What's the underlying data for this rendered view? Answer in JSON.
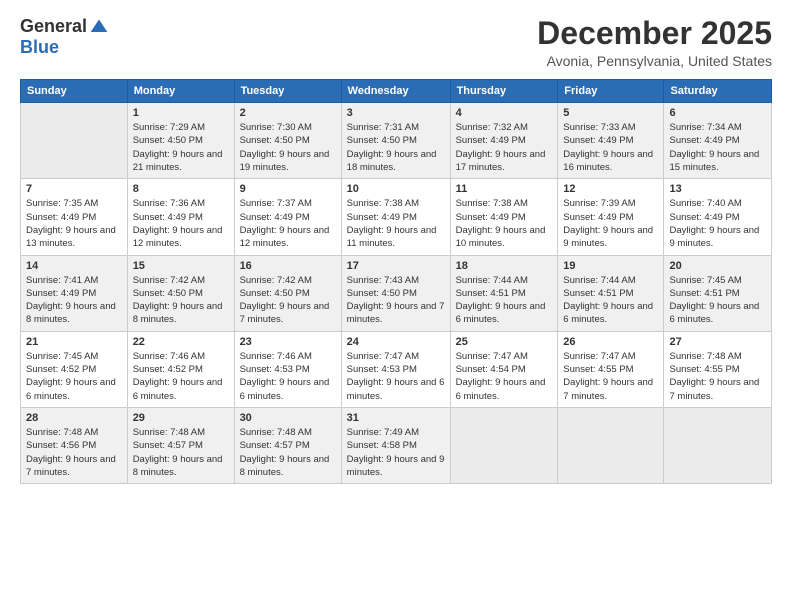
{
  "logo": {
    "general": "General",
    "blue": "Blue"
  },
  "header": {
    "month": "December 2025",
    "location": "Avonia, Pennsylvania, United States"
  },
  "weekdays": [
    "Sunday",
    "Monday",
    "Tuesday",
    "Wednesday",
    "Thursday",
    "Friday",
    "Saturday"
  ],
  "weeks": [
    [
      {
        "day": "",
        "sunrise": "",
        "sunset": "",
        "daylight": ""
      },
      {
        "day": "1",
        "sunrise": "Sunrise: 7:29 AM",
        "sunset": "Sunset: 4:50 PM",
        "daylight": "Daylight: 9 hours and 21 minutes."
      },
      {
        "day": "2",
        "sunrise": "Sunrise: 7:30 AM",
        "sunset": "Sunset: 4:50 PM",
        "daylight": "Daylight: 9 hours and 19 minutes."
      },
      {
        "day": "3",
        "sunrise": "Sunrise: 7:31 AM",
        "sunset": "Sunset: 4:50 PM",
        "daylight": "Daylight: 9 hours and 18 minutes."
      },
      {
        "day": "4",
        "sunrise": "Sunrise: 7:32 AM",
        "sunset": "Sunset: 4:49 PM",
        "daylight": "Daylight: 9 hours and 17 minutes."
      },
      {
        "day": "5",
        "sunrise": "Sunrise: 7:33 AM",
        "sunset": "Sunset: 4:49 PM",
        "daylight": "Daylight: 9 hours and 16 minutes."
      },
      {
        "day": "6",
        "sunrise": "Sunrise: 7:34 AM",
        "sunset": "Sunset: 4:49 PM",
        "daylight": "Daylight: 9 hours and 15 minutes."
      }
    ],
    [
      {
        "day": "7",
        "sunrise": "Sunrise: 7:35 AM",
        "sunset": "Sunset: 4:49 PM",
        "daylight": "Daylight: 9 hours and 13 minutes."
      },
      {
        "day": "8",
        "sunrise": "Sunrise: 7:36 AM",
        "sunset": "Sunset: 4:49 PM",
        "daylight": "Daylight: 9 hours and 12 minutes."
      },
      {
        "day": "9",
        "sunrise": "Sunrise: 7:37 AM",
        "sunset": "Sunset: 4:49 PM",
        "daylight": "Daylight: 9 hours and 12 minutes."
      },
      {
        "day": "10",
        "sunrise": "Sunrise: 7:38 AM",
        "sunset": "Sunset: 4:49 PM",
        "daylight": "Daylight: 9 hours and 11 minutes."
      },
      {
        "day": "11",
        "sunrise": "Sunrise: 7:38 AM",
        "sunset": "Sunset: 4:49 PM",
        "daylight": "Daylight: 9 hours and 10 minutes."
      },
      {
        "day": "12",
        "sunrise": "Sunrise: 7:39 AM",
        "sunset": "Sunset: 4:49 PM",
        "daylight": "Daylight: 9 hours and 9 minutes."
      },
      {
        "day": "13",
        "sunrise": "Sunrise: 7:40 AM",
        "sunset": "Sunset: 4:49 PM",
        "daylight": "Daylight: 9 hours and 9 minutes."
      }
    ],
    [
      {
        "day": "14",
        "sunrise": "Sunrise: 7:41 AM",
        "sunset": "Sunset: 4:49 PM",
        "daylight": "Daylight: 9 hours and 8 minutes."
      },
      {
        "day": "15",
        "sunrise": "Sunrise: 7:42 AM",
        "sunset": "Sunset: 4:50 PM",
        "daylight": "Daylight: 9 hours and 8 minutes."
      },
      {
        "day": "16",
        "sunrise": "Sunrise: 7:42 AM",
        "sunset": "Sunset: 4:50 PM",
        "daylight": "Daylight: 9 hours and 7 minutes."
      },
      {
        "day": "17",
        "sunrise": "Sunrise: 7:43 AM",
        "sunset": "Sunset: 4:50 PM",
        "daylight": "Daylight: 9 hours and 7 minutes."
      },
      {
        "day": "18",
        "sunrise": "Sunrise: 7:44 AM",
        "sunset": "Sunset: 4:51 PM",
        "daylight": "Daylight: 9 hours and 6 minutes."
      },
      {
        "day": "19",
        "sunrise": "Sunrise: 7:44 AM",
        "sunset": "Sunset: 4:51 PM",
        "daylight": "Daylight: 9 hours and 6 minutes."
      },
      {
        "day": "20",
        "sunrise": "Sunrise: 7:45 AM",
        "sunset": "Sunset: 4:51 PM",
        "daylight": "Daylight: 9 hours and 6 minutes."
      }
    ],
    [
      {
        "day": "21",
        "sunrise": "Sunrise: 7:45 AM",
        "sunset": "Sunset: 4:52 PM",
        "daylight": "Daylight: 9 hours and 6 minutes."
      },
      {
        "day": "22",
        "sunrise": "Sunrise: 7:46 AM",
        "sunset": "Sunset: 4:52 PM",
        "daylight": "Daylight: 9 hours and 6 minutes."
      },
      {
        "day": "23",
        "sunrise": "Sunrise: 7:46 AM",
        "sunset": "Sunset: 4:53 PM",
        "daylight": "Daylight: 9 hours and 6 minutes."
      },
      {
        "day": "24",
        "sunrise": "Sunrise: 7:47 AM",
        "sunset": "Sunset: 4:53 PM",
        "daylight": "Daylight: 9 hours and 6 minutes."
      },
      {
        "day": "25",
        "sunrise": "Sunrise: 7:47 AM",
        "sunset": "Sunset: 4:54 PM",
        "daylight": "Daylight: 9 hours and 6 minutes."
      },
      {
        "day": "26",
        "sunrise": "Sunrise: 7:47 AM",
        "sunset": "Sunset: 4:55 PM",
        "daylight": "Daylight: 9 hours and 7 minutes."
      },
      {
        "day": "27",
        "sunrise": "Sunrise: 7:48 AM",
        "sunset": "Sunset: 4:55 PM",
        "daylight": "Daylight: 9 hours and 7 minutes."
      }
    ],
    [
      {
        "day": "28",
        "sunrise": "Sunrise: 7:48 AM",
        "sunset": "Sunset: 4:56 PM",
        "daylight": "Daylight: 9 hours and 7 minutes."
      },
      {
        "day": "29",
        "sunrise": "Sunrise: 7:48 AM",
        "sunset": "Sunset: 4:57 PM",
        "daylight": "Daylight: 9 hours and 8 minutes."
      },
      {
        "day": "30",
        "sunrise": "Sunrise: 7:48 AM",
        "sunset": "Sunset: 4:57 PM",
        "daylight": "Daylight: 9 hours and 8 minutes."
      },
      {
        "day": "31",
        "sunrise": "Sunrise: 7:49 AM",
        "sunset": "Sunset: 4:58 PM",
        "daylight": "Daylight: 9 hours and 9 minutes."
      },
      {
        "day": "",
        "sunrise": "",
        "sunset": "",
        "daylight": ""
      },
      {
        "day": "",
        "sunrise": "",
        "sunset": "",
        "daylight": ""
      },
      {
        "day": "",
        "sunrise": "",
        "sunset": "",
        "daylight": ""
      }
    ]
  ]
}
